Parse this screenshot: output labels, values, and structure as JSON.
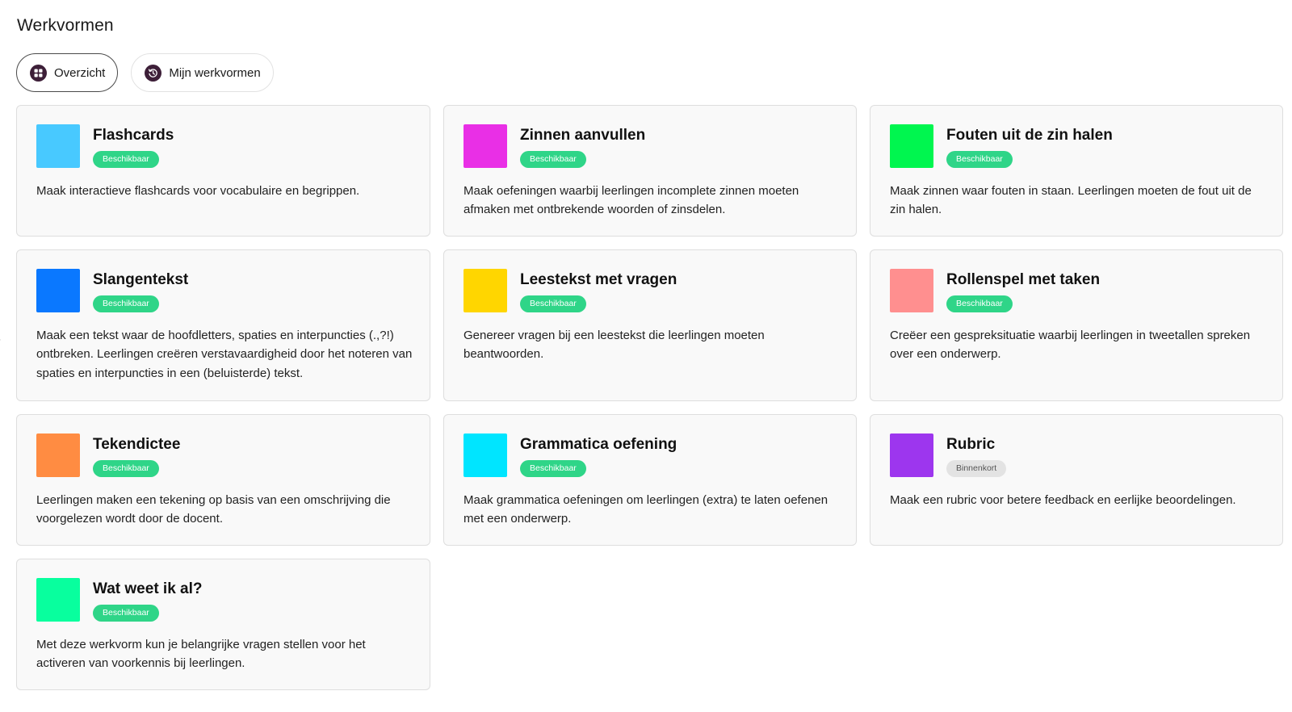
{
  "page": {
    "title": "Werkvormen"
  },
  "tabs": [
    {
      "label": "Overzicht",
      "icon": "grid-icon",
      "active": true
    },
    {
      "label": "Mijn werkvormen",
      "icon": "history-icon",
      "active": false
    }
  ],
  "colors": {
    "available_badge": "#2fd588",
    "soon_badge": "#e3e3e3",
    "tab_icon": "#3d1f38"
  },
  "cards": [
    {
      "title": "Flashcards",
      "color": "#48c9ff",
      "status": "Beschikbaar",
      "status_type": "available",
      "description": "Maak interactieve flashcards voor vocabulaire en begrippen."
    },
    {
      "title": "Zinnen aanvullen",
      "color": "#e92fe6",
      "status": "Beschikbaar",
      "status_type": "available",
      "description": "Maak oefeningen waarbij leerlingen incomplete zinnen moeten afmaken met ontbrekende woorden of zinsdelen."
    },
    {
      "title": "Fouten uit de zin halen",
      "color": "#00f64f",
      "status": "Beschikbaar",
      "status_type": "available",
      "description": "Maak zinnen waar fouten in staan. Leerlingen moeten de fout uit de zin halen."
    },
    {
      "title": "Slangentekst",
      "color": "#0a78ff",
      "status": "Beschikbaar",
      "status_type": "available",
      "description": "Maak een tekst waar de hoofdletters, spaties en interpuncties (.,?!) ontbreken. Leerlingen creëren verstavaardigheid door het noteren van spaties en interpuncties in een (beluisterde) tekst."
    },
    {
      "title": "Leestekst met vragen",
      "color": "#ffd600",
      "status": "Beschikbaar",
      "status_type": "available",
      "description": "Genereer vragen bij een leestekst die leerlingen moeten beantwoorden."
    },
    {
      "title": "Rollenspel met taken",
      "color": "#ff8f8f",
      "status": "Beschikbaar",
      "status_type": "available",
      "description": "Creëer een gespreksituatie waarbij leerlingen in tweetallen spreken over een onderwerp."
    },
    {
      "title": "Tekendictee",
      "color": "#ff8c42",
      "status": "Beschikbaar",
      "status_type": "available",
      "description": "Leerlingen maken een tekening op basis van een omschrijving die voorgelezen wordt door de docent."
    },
    {
      "title": "Grammatica oefening",
      "color": "#00e5ff",
      "status": "Beschikbaar",
      "status_type": "available",
      "description": "Maak grammatica oefeningen om leerlingen (extra) te laten oefenen met een onderwerp."
    },
    {
      "title": "Rubric",
      "color": "#9d36ee",
      "status": "Binnenkort",
      "status_type": "soon",
      "description": "Maak een rubric voor betere feedback en eerlijke beoordelingen."
    },
    {
      "title": "Wat weet ik al?",
      "color": "#08ff9e",
      "status": "Beschikbaar",
      "status_type": "available",
      "description": "Met deze werkvorm kun je belangrijke vragen stellen voor het activeren van voorkennis bij leerlingen."
    }
  ]
}
